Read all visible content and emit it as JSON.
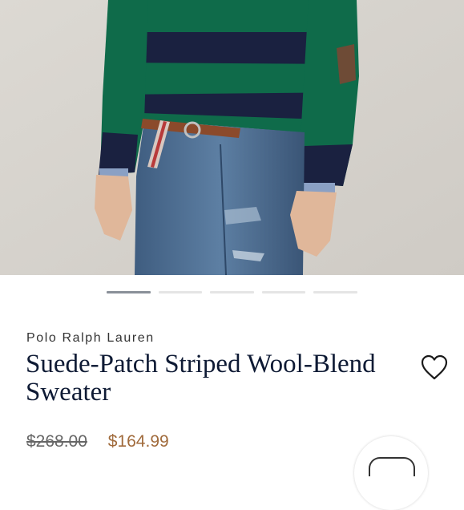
{
  "product": {
    "brand": "Polo Ralph Lauren",
    "title": "Suede-Patch Striped Wool-Blend Sweater",
    "original_price": "$268.00",
    "sale_price": "$164.99"
  },
  "gallery": {
    "image_count": 5,
    "active_index": 0
  },
  "icons": {
    "wishlist": "heart-outline-icon",
    "chat": "chat-icon"
  },
  "colors": {
    "title": "#0e1a34",
    "sale_price": "#a06a3b",
    "pager_active": "#8a9099",
    "pager_inactive": "#e5e5e5"
  }
}
